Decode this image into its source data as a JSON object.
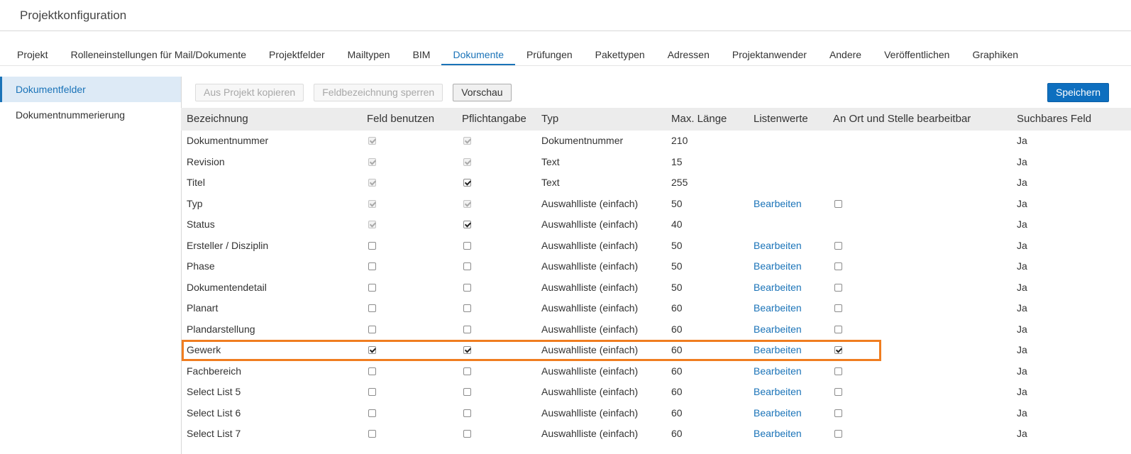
{
  "page": {
    "title": "Projektkonfiguration"
  },
  "nav": {
    "tabs": [
      {
        "label": "Projekt"
      },
      {
        "label": "Rolleneinstellungen für Mail/Dokumente"
      },
      {
        "label": "Projektfelder"
      },
      {
        "label": "Mailtypen"
      },
      {
        "label": "BIM"
      },
      {
        "label": "Dokumente"
      },
      {
        "label": "Prüfungen"
      },
      {
        "label": "Pakettypen"
      },
      {
        "label": "Adressen"
      },
      {
        "label": "Projektanwender"
      },
      {
        "label": "Andere"
      },
      {
        "label": "Veröffentlichen"
      },
      {
        "label": "Graphiken"
      }
    ],
    "active_tab": "Dokumente"
  },
  "sidebar": {
    "items": [
      {
        "label": "Dokumentfelder",
        "active": true
      },
      {
        "label": "Dokumentnummerierung",
        "active": false
      }
    ]
  },
  "toolbar": {
    "copy_label": "Aus Projekt kopieren",
    "lock_label": "Feldbezeichnung sperren",
    "preview_label": "Vorschau",
    "save_label": "Speichern"
  },
  "table": {
    "columns": {
      "name": "Bezeichnung",
      "use": "Feld benutzen",
      "required": "Pflichtangabe",
      "type": "Typ",
      "max_length": "Max. Länge",
      "list_values": "Listenwerte",
      "inline_edit": "An Ort und Stelle bearbeitbar",
      "searchable": "Suchbares Feld"
    },
    "rows": [
      {
        "name": "Dokumentnummer",
        "use": true,
        "use_disabled": true,
        "required": true,
        "required_disabled": true,
        "type": "Dokumentnummer",
        "max_length": "210",
        "list_values": "",
        "inline_edit": null,
        "searchable": "Ja"
      },
      {
        "name": "Revision",
        "use": true,
        "use_disabled": true,
        "required": true,
        "required_disabled": true,
        "type": "Text",
        "max_length": "15",
        "list_values": "",
        "inline_edit": null,
        "searchable": "Ja"
      },
      {
        "name": "Titel",
        "use": true,
        "use_disabled": true,
        "required": true,
        "required_disabled": false,
        "type": "Text",
        "max_length": "255",
        "list_values": "",
        "inline_edit": null,
        "searchable": "Ja"
      },
      {
        "name": "Typ",
        "use": true,
        "use_disabled": true,
        "required": true,
        "required_disabled": true,
        "type": "Auswahlliste (einfach)",
        "max_length": "50",
        "list_values": "Bearbeiten",
        "inline_edit": false,
        "searchable": "Ja"
      },
      {
        "name": "Status",
        "use": true,
        "use_disabled": true,
        "required": true,
        "required_disabled": false,
        "type": "Auswahlliste (einfach)",
        "max_length": "40",
        "list_values": "",
        "inline_edit": null,
        "searchable": "Ja"
      },
      {
        "name": "Ersteller / Disziplin",
        "use": false,
        "use_disabled": false,
        "required": false,
        "required_disabled": false,
        "type": "Auswahlliste (einfach)",
        "max_length": "50",
        "list_values": "Bearbeiten",
        "inline_edit": false,
        "searchable": "Ja"
      },
      {
        "name": "Phase",
        "use": false,
        "use_disabled": false,
        "required": false,
        "required_disabled": false,
        "type": "Auswahlliste (einfach)",
        "max_length": "50",
        "list_values": "Bearbeiten",
        "inline_edit": false,
        "searchable": "Ja"
      },
      {
        "name": "Dokumentendetail",
        "use": false,
        "use_disabled": false,
        "required": false,
        "required_disabled": false,
        "type": "Auswahlliste (einfach)",
        "max_length": "50",
        "list_values": "Bearbeiten",
        "inline_edit": false,
        "searchable": "Ja"
      },
      {
        "name": "Planart",
        "use": false,
        "use_disabled": false,
        "required": false,
        "required_disabled": false,
        "type": "Auswahlliste (einfach)",
        "max_length": "60",
        "list_values": "Bearbeiten",
        "inline_edit": false,
        "searchable": "Ja"
      },
      {
        "name": "Plandarstellung",
        "use": false,
        "use_disabled": false,
        "required": false,
        "required_disabled": false,
        "type": "Auswahlliste (einfach)",
        "max_length": "60",
        "list_values": "Bearbeiten",
        "inline_edit": false,
        "searchable": "Ja"
      },
      {
        "name": "Gewerk",
        "use": true,
        "use_disabled": false,
        "required": true,
        "required_disabled": false,
        "type": "Auswahlliste (einfach)",
        "max_length": "60",
        "list_values": "Bearbeiten",
        "inline_edit": true,
        "searchable": "Ja",
        "highlighted": true
      },
      {
        "name": "Fachbereich",
        "use": false,
        "use_disabled": false,
        "required": false,
        "required_disabled": false,
        "type": "Auswahlliste (einfach)",
        "max_length": "60",
        "list_values": "Bearbeiten",
        "inline_edit": false,
        "searchable": "Ja"
      },
      {
        "name": "Select List 5",
        "use": false,
        "use_disabled": false,
        "required": false,
        "required_disabled": false,
        "type": "Auswahlliste (einfach)",
        "max_length": "60",
        "list_values": "Bearbeiten",
        "inline_edit": false,
        "searchable": "Ja"
      },
      {
        "name": "Select List 6",
        "use": false,
        "use_disabled": false,
        "required": false,
        "required_disabled": false,
        "type": "Auswahlliste (einfach)",
        "max_length": "60",
        "list_values": "Bearbeiten",
        "inline_edit": false,
        "searchable": "Ja"
      },
      {
        "name": "Select List 7",
        "use": false,
        "use_disabled": false,
        "required": false,
        "required_disabled": false,
        "type": "Auswahlliste (einfach)",
        "max_length": "60",
        "list_values": "Bearbeiten",
        "inline_edit": false,
        "searchable": "Ja"
      }
    ]
  },
  "colors": {
    "accent": "#1a73b8",
    "primary_button": "#0e6fbf",
    "highlight_border": "#f07d20",
    "header_bg": "#ececec",
    "sidebar_active_bg": "#ddeaf6"
  }
}
